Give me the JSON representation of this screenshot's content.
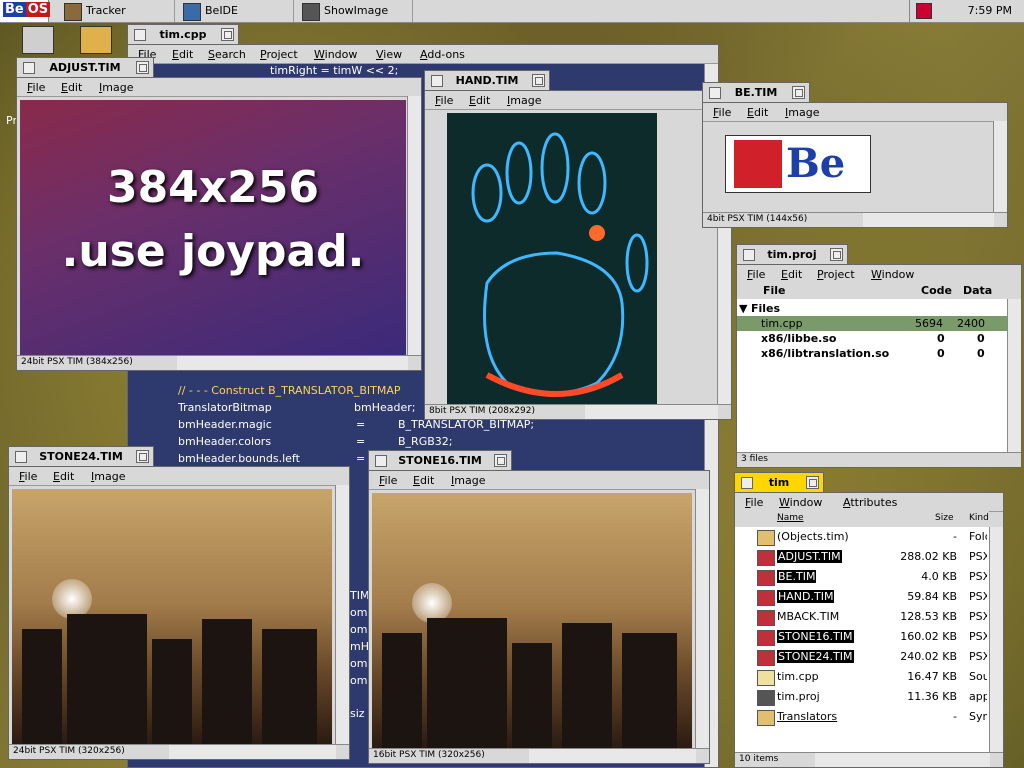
{
  "deskbar": {
    "logo_be": "Be",
    "logo_os": "OS",
    "apps": [
      "Tracker",
      "BeIDE",
      "ShowImage"
    ],
    "time": "7:59 PM"
  },
  "desktop": {
    "peek_letter": "Pr"
  },
  "tim_cpp": {
    "title": "tim.cpp",
    "menus": [
      "File",
      "Edit",
      "Search",
      "Project",
      "Window",
      "View",
      "Add-ons"
    ],
    "code_top": "timRight = timW << 2;",
    "comment": "// - - - Construct B_TRANSLATOR_BITMAP",
    "lines": [
      {
        "left": "TranslatorBitmap",
        "right": "bmHeader;"
      },
      {
        "left": "bmHeader.magic",
        "eq": "=",
        "right": "B_TRANSLATOR_BITMAP;"
      },
      {
        "left": "bmHeader.colors",
        "eq": "=",
        "right": "B_RGB32;"
      },
      {
        "left": "bmHeader.bounds.left",
        "eq": "=",
        "right": ""
      }
    ],
    "partial": [
      "TIM",
      "om",
      "om",
      "mH",
      "om",
      "om",
      "siz"
    ]
  },
  "adjust": {
    "title": "ADJUST.TIM",
    "menus": [
      "File",
      "Edit",
      "Image"
    ],
    "line1": "384x256",
    "line2": ".use joypad.",
    "status": "24bit PSX TIM (384x256)"
  },
  "hand": {
    "title": "HAND.TIM",
    "menus": [
      "File",
      "Edit",
      "Image"
    ],
    "status": "8bit PSX TIM (208x292)"
  },
  "be_tim": {
    "title": "BE.TIM",
    "menus": [
      "File",
      "Edit",
      "Image"
    ],
    "logo_text": "Be",
    "status": "4bit PSX TIM (144x56)"
  },
  "proj": {
    "title": "tim.proj",
    "menus": [
      "File",
      "Edit",
      "Project",
      "Window"
    ],
    "cols": {
      "file": "File",
      "code": "Code",
      "data": "Data"
    },
    "group": "Files",
    "rows": [
      {
        "name": "tim.cpp",
        "code": "5694",
        "data": "2400"
      },
      {
        "name": "x86/libbe.so",
        "code": "0",
        "data": "0"
      },
      {
        "name": "x86/libtranslation.so",
        "code": "0",
        "data": "0"
      }
    ],
    "status": "3 files"
  },
  "stone24": {
    "title": "STONE24.TIM",
    "menus": [
      "File",
      "Edit",
      "Image"
    ],
    "status": "24bit PSX TIM (320x256)"
  },
  "stone16": {
    "title": "STONE16.TIM",
    "menus": [
      "File",
      "Edit",
      "Image"
    ],
    "status": "16bit PSX TIM (320x256)"
  },
  "tracker": {
    "title": "tim",
    "menus": [
      "File",
      "Window",
      "Attributes"
    ],
    "cols": {
      "name": "Name",
      "size": "Size",
      "kind": "Kind"
    },
    "rows": [
      {
        "name": "(Objects.tim)",
        "size": "-",
        "kind": "Fold",
        "hl": false,
        "icon": "folder-icon"
      },
      {
        "name": "ADJUST.TIM",
        "size": "288.02 KB",
        "kind": "PSX",
        "hl": true,
        "icon": "tim-file-icon"
      },
      {
        "name": "BE.TIM",
        "size": "4.0 KB",
        "kind": "PSX",
        "hl": true,
        "icon": "tim-file-icon"
      },
      {
        "name": "HAND.TIM",
        "size": "59.84 KB",
        "kind": "PSX",
        "hl": true,
        "icon": "tim-file-icon"
      },
      {
        "name": "MBACK.TIM",
        "size": "128.53 KB",
        "kind": "PSX",
        "hl": false,
        "icon": "tim-file-icon"
      },
      {
        "name": "STONE16.TIM",
        "size": "160.02 KB",
        "kind": "PSX",
        "hl": true,
        "icon": "tim-file-icon"
      },
      {
        "name": "STONE24.TIM",
        "size": "240.02 KB",
        "kind": "PSX",
        "hl": true,
        "icon": "tim-file-icon"
      },
      {
        "name": "tim.cpp",
        "size": "16.47 KB",
        "kind": "Sou",
        "hl": false,
        "icon": "source-file-icon"
      },
      {
        "name": "tim.proj",
        "size": "11.36 KB",
        "kind": "app",
        "hl": false,
        "icon": "project-file-icon"
      },
      {
        "name": "Translators",
        "size": "-",
        "kind": "Sym",
        "hl": false,
        "icon": "folder-link-icon"
      }
    ],
    "status": "10 items"
  }
}
